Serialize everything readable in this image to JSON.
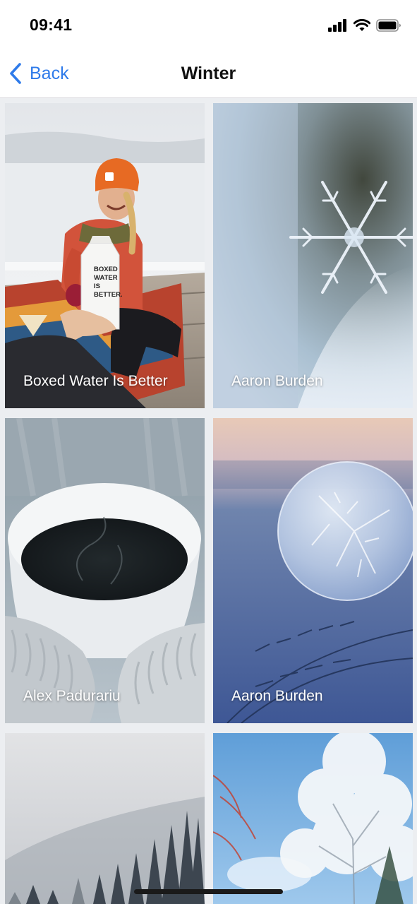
{
  "status_bar": {
    "time": "09:41",
    "icons": [
      "cellular-signal-icon",
      "wifi-icon",
      "battery-icon"
    ]
  },
  "nav": {
    "back_label": "Back",
    "title": "Winter",
    "accent_color": "#2f7bea"
  },
  "photos": [
    {
      "caption": "Boxed Water Is Better",
      "subject": "woman in orange hat handing a boxed water carton",
      "carton_text": "BOXED WATER IS BETTER."
    },
    {
      "caption": "Aaron Burden",
      "subject": "snowflake close-up"
    },
    {
      "caption": "Alex Padurariu",
      "subject": "cup of coffee held in knitted mittens"
    },
    {
      "caption": "Aaron Burden",
      "subject": "frozen soap bubble"
    },
    {
      "caption": "",
      "subject": "foggy snowy forest"
    },
    {
      "caption": "",
      "subject": "frosted trees against blue sky"
    }
  ]
}
